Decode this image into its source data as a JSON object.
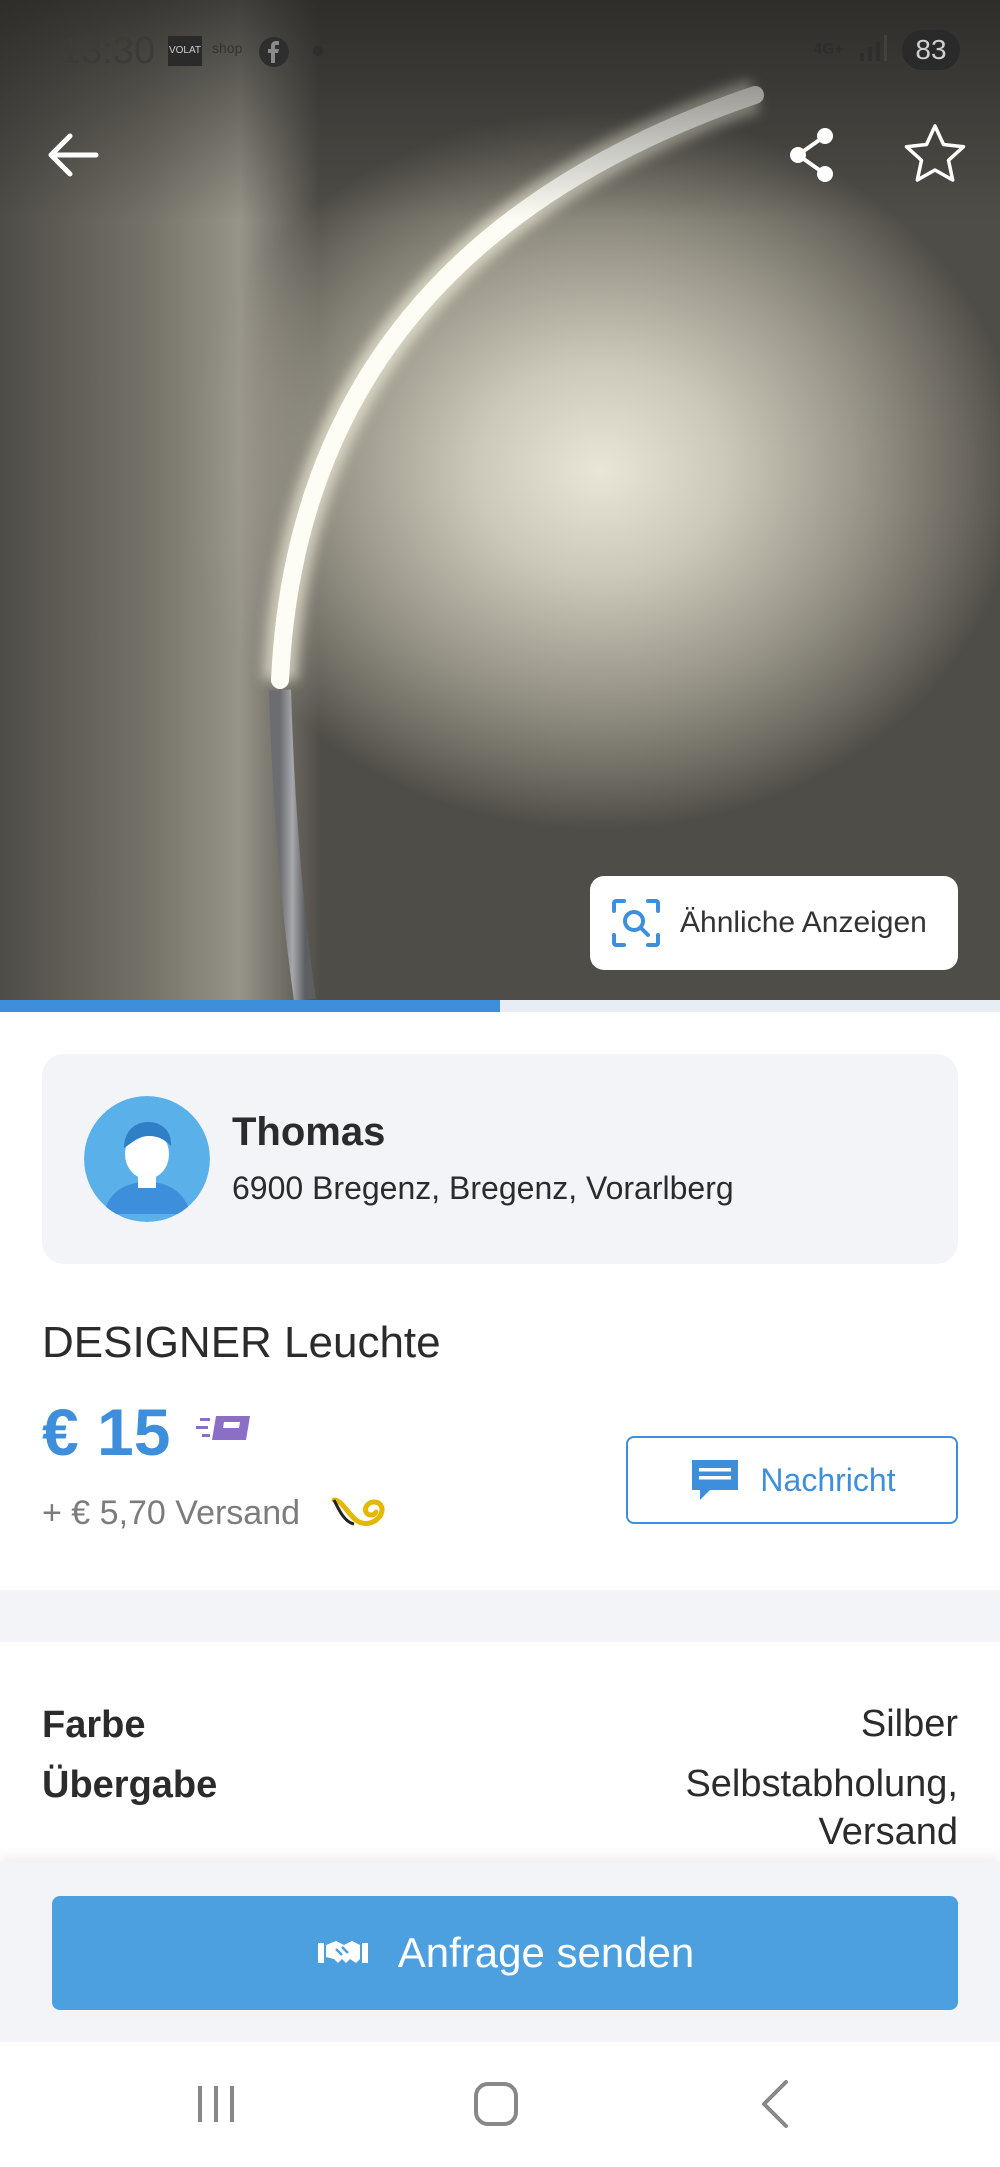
{
  "status_bar": {
    "time": "13:30",
    "app_icon_1": "VOLAT",
    "app_icon_2": "shop",
    "network": "4G+",
    "battery": "83"
  },
  "top_actions": {
    "back_icon": "arrow-left-icon",
    "share_icon": "share-icon",
    "favorite_icon": "star-outline-icon"
  },
  "gallery": {
    "similar_ads_label": "Ähnliche Anzeigen",
    "progress": 0.5
  },
  "seller": {
    "name": "Thomas",
    "location": "6900 Bregenz, Bregenz, Vorarlberg"
  },
  "listing": {
    "title": "DESIGNER Leuchte",
    "price": "€ 15",
    "shipping": "+ € 5,70 Versand",
    "message_label": "Nachricht"
  },
  "attributes": [
    {
      "label": "Farbe",
      "value": "Silber"
    },
    {
      "label": "Übergabe",
      "value": "Selbstabholung,\nVersand"
    }
  ],
  "cta": {
    "request_label": "Anfrage senden"
  },
  "colors": {
    "accent": "#3d8fdb",
    "cta": "#4ca0e0",
    "card_bg": "#f2f4f8"
  }
}
